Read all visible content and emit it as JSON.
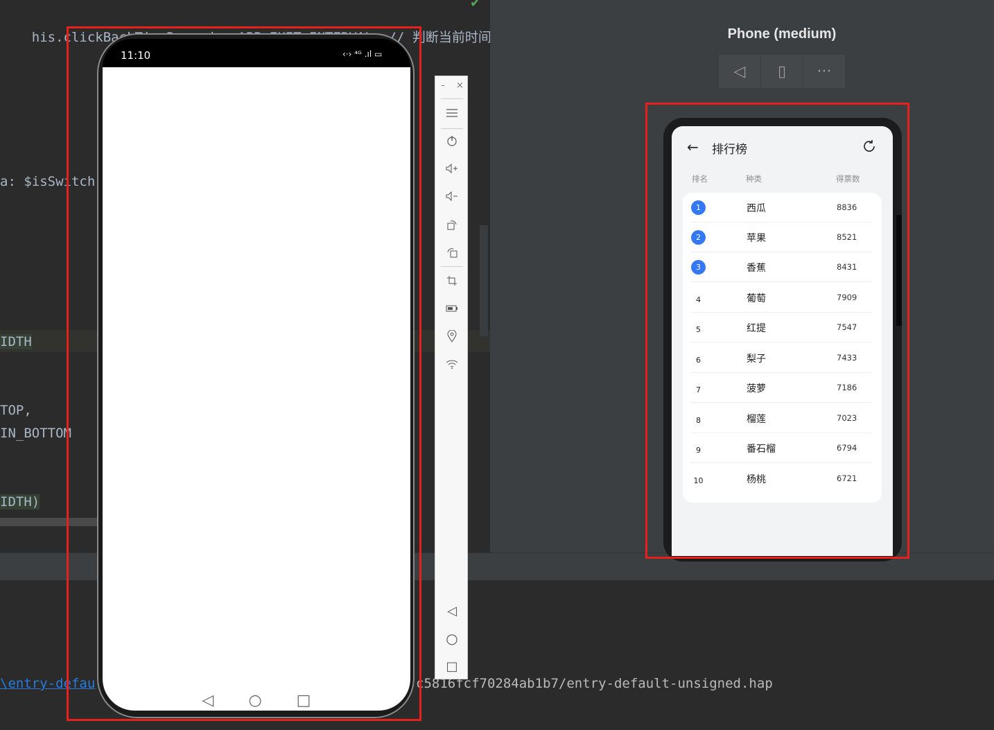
{
  "editor": {
    "line1": "his.clickBackTimeRecord > APP_EXIT_INTERVAL; // 判断当前时间与",
    "line2": "a: $isSwitch",
    "line3": "IDTH",
    "line4": "TOP,",
    "line5": "IN_BOTTOM",
    "line6": "IDTH)"
  },
  "console": {
    "link_text": "\\entry-defau",
    "path_text": "c5816fcf70284ab1b7/entry-default-unsigned.hap"
  },
  "emulator": {
    "status_time": "11:10",
    "status_icons": "‹·› ⁴ᴳ .ıl ▭",
    "toolbar_icons": [
      "menu-icon",
      "power-icon",
      "volume-up-icon",
      "volume-down-icon",
      "rotate-icon",
      "rotate-alt-icon",
      "crop-icon",
      "battery-icon",
      "location-icon",
      "wifi-icon",
      "back-icon",
      "home-icon",
      "recent-icon"
    ],
    "nav": {
      "back": "◁",
      "home": "○",
      "recent": "□"
    }
  },
  "preview": {
    "device_name": "Phone (medium)",
    "controls": [
      "◁",
      "▯",
      "···"
    ],
    "app": {
      "title": "排行榜",
      "columns": {
        "rank": "排名",
        "category": "种类",
        "votes": "得票数"
      },
      "rows": [
        {
          "rank": "1",
          "name": "西瓜",
          "votes": "8836"
        },
        {
          "rank": "2",
          "name": "苹果",
          "votes": "8521"
        },
        {
          "rank": "3",
          "name": "香蕉",
          "votes": "8431"
        },
        {
          "rank": "4",
          "name": "葡萄",
          "votes": "7909"
        },
        {
          "rank": "5",
          "name": "红提",
          "votes": "7547"
        },
        {
          "rank": "6",
          "name": "梨子",
          "votes": "7433"
        },
        {
          "rank": "7",
          "name": "菠萝",
          "votes": "7186"
        },
        {
          "rank": "8",
          "name": "榴莲",
          "votes": "7023"
        },
        {
          "rank": "9",
          "name": "番石榴",
          "votes": "6794"
        },
        {
          "rank": "10",
          "name": "杨桃",
          "votes": "6721"
        }
      ]
    }
  },
  "colors": {
    "accent": "#3478f6",
    "annotation": "#e8201c"
  }
}
